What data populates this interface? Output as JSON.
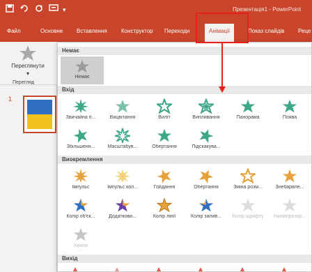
{
  "window": {
    "title": "Презентація1 - PowerPoint",
    "quick_access": [
      "save-icon",
      "undo-icon",
      "redo-icon",
      "presenter-icon",
      "customize-icon"
    ]
  },
  "ribbon": {
    "tabs": [
      "Файл",
      "Основне",
      "Вставлення",
      "Конструктор",
      "Переходи",
      "Анімації",
      "Показ слайдів",
      "Реце"
    ],
    "active_tab": "Анімації",
    "preview_label": "Переглянути",
    "preview_group": "Перегляд"
  },
  "slides": {
    "current_number": "1"
  },
  "gallery": {
    "sections": [
      {
        "title": "Немає",
        "items": [
          {
            "label": "Немає",
            "icon": "star-gray"
          }
        ]
      },
      {
        "title": "Вхід",
        "items": [
          {
            "label": "Звичайна п...",
            "icon": "star-teal"
          },
          {
            "label": "Вицвітання",
            "icon": "star-teal"
          },
          {
            "label": "Виліт",
            "icon": "star-teal"
          },
          {
            "label": "Випливання",
            "icon": "star-teal"
          },
          {
            "label": "Панорама",
            "icon": "star-teal"
          },
          {
            "label": "Поява",
            "icon": "star-teal"
          },
          {
            "label": "Збільшенн...",
            "icon": "star-teal"
          },
          {
            "label": "Масштабув...",
            "icon": "star-teal"
          },
          {
            "label": "Обертання",
            "icon": "star-teal"
          },
          {
            "label": "Підскакува...",
            "icon": "star-teal"
          }
        ]
      },
      {
        "title": "Виокремлення",
        "items": [
          {
            "label": "Імпульс",
            "icon": "star-gold"
          },
          {
            "label": "Імпульс кол...",
            "icon": "star-gold"
          },
          {
            "label": "Гойдання",
            "icon": "star-gold"
          },
          {
            "label": "Обертання",
            "icon": "star-gold"
          },
          {
            "label": "Зміна розм...",
            "icon": "star-gold"
          },
          {
            "label": "Знебарвле...",
            "icon": "star-gold"
          },
          {
            "label": "Колір об'єк...",
            "icon": "star-blue"
          },
          {
            "label": "Додаткови...",
            "icon": "star-purple"
          },
          {
            "label": "Колір лінії",
            "icon": "star-gold"
          },
          {
            "label": "Колір залив...",
            "icon": "star-blue"
          },
          {
            "label": "Колір шрифту",
            "icon": "star-faint"
          },
          {
            "label": "Напівпрозор...",
            "icon": "star-faint"
          },
          {
            "label": "Хвиля",
            "icon": "star-faint"
          }
        ]
      },
      {
        "title": "Вихід",
        "items": []
      }
    ]
  },
  "colors": {
    "accent": "#c8452b",
    "highlight_box": "#e8201b",
    "teal": "#3fa88a",
    "gold": "#e6a23c",
    "blue": "#2e6fc4"
  }
}
